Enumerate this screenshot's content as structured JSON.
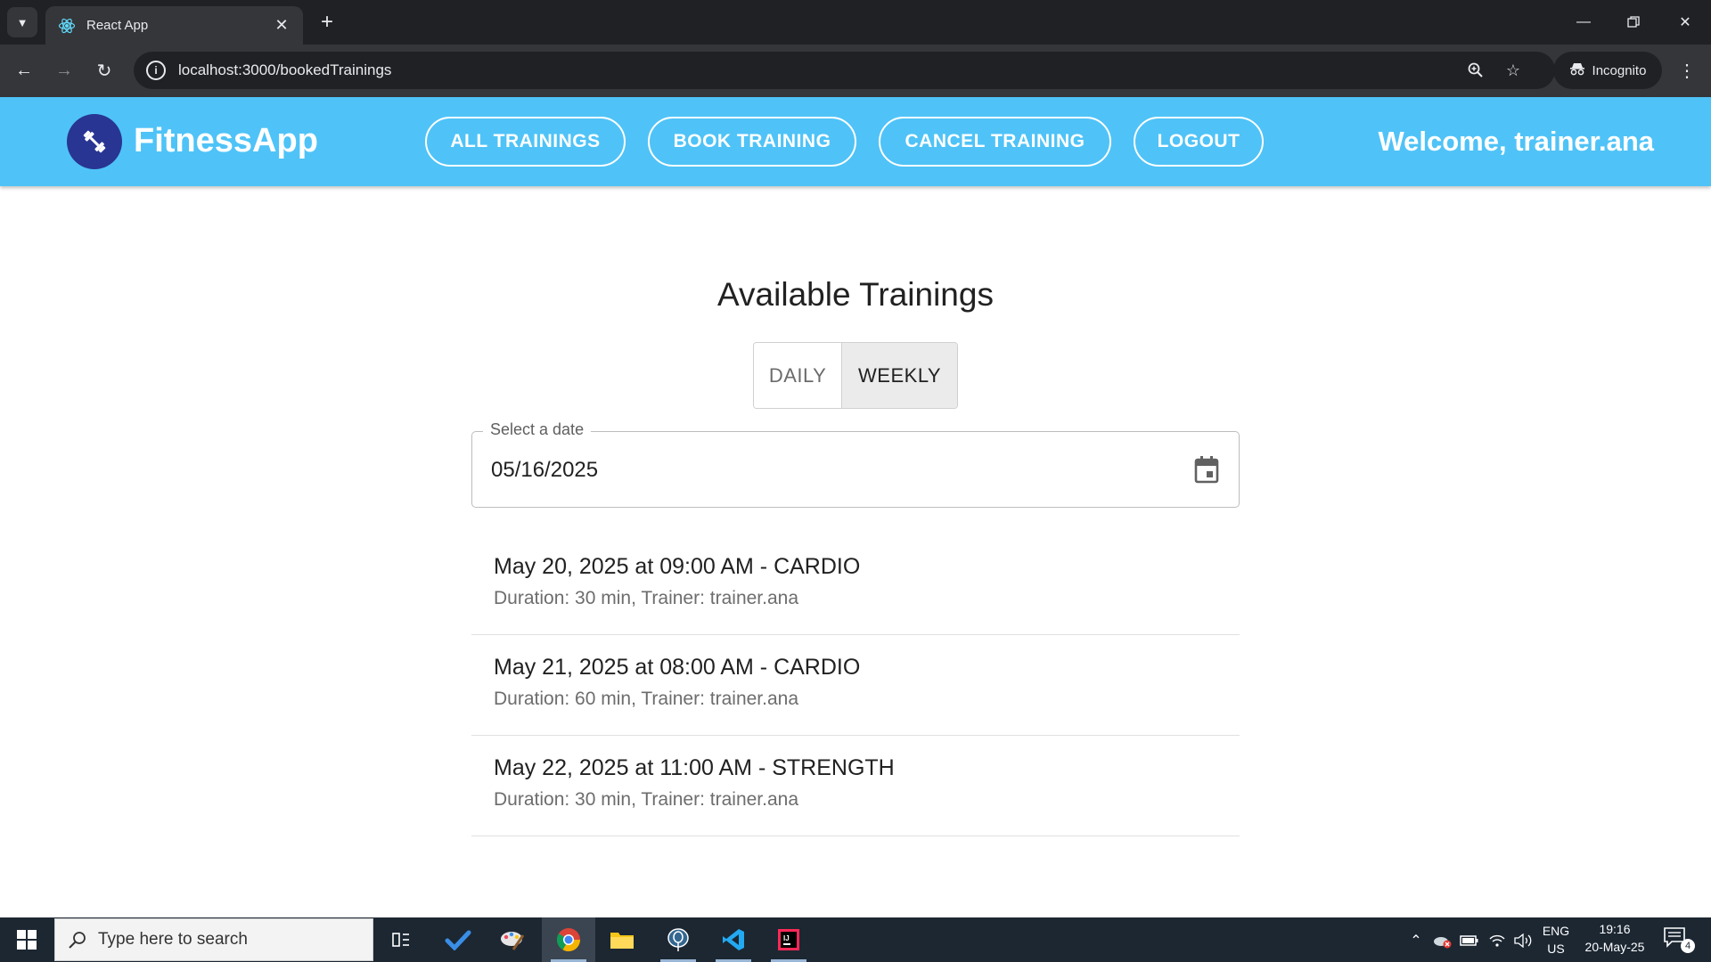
{
  "browser": {
    "tab_title": "React App",
    "url": "localhost:3000/bookedTrainings",
    "incognito_label": "Incognito"
  },
  "app": {
    "brand": "FitnessApp",
    "nav": {
      "all_trainings": "ALL TRAININGS",
      "book_training": "BOOK TRAINING",
      "cancel_training": "CANCEL TRAINING",
      "logout": "LOGOUT"
    },
    "welcome": "Welcome, trainer.ana"
  },
  "main": {
    "title": "Available Trainings",
    "view_toggle": {
      "daily": "DAILY",
      "weekly": "WEEKLY",
      "selected": "WEEKLY"
    },
    "date_picker": {
      "label": "Select a date",
      "value": "05/16/2025"
    },
    "trainings": [
      {
        "title": "May 20, 2025 at 09:00 AM - CARDIO",
        "details": "Duration: 30 min, Trainer: trainer.ana"
      },
      {
        "title": "May 21, 2025 at 08:00 AM - CARDIO",
        "details": "Duration: 60 min, Trainer: trainer.ana"
      },
      {
        "title": "May 22, 2025 at 11:00 AM - STRENGTH",
        "details": "Duration: 30 min, Trainer: trainer.ana"
      }
    ]
  },
  "taskbar": {
    "search_placeholder": "Type here to search",
    "language_line1": "ENG",
    "language_line2": "US",
    "time": "19:16",
    "date": "20-May-25",
    "notification_count": "4"
  },
  "colors": {
    "header": "#4fc3f7",
    "logo_circle": "#283593",
    "text_primary": "#212121",
    "text_secondary": "#6d6d6d"
  }
}
